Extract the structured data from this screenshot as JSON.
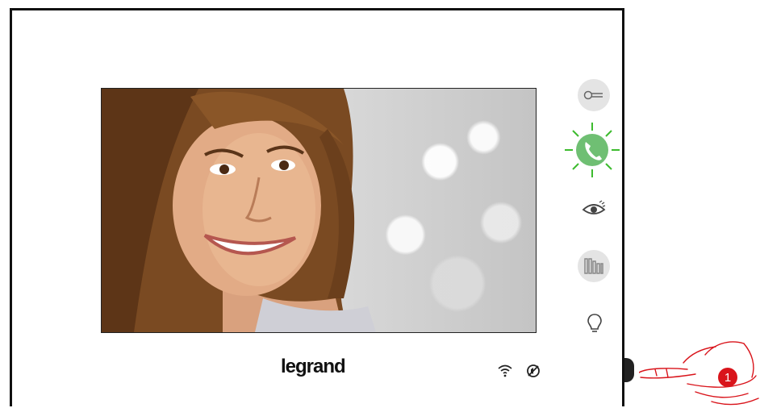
{
  "brand": {
    "logo_text": "legrand"
  },
  "video": {
    "description_icon": "visitor-video-feed"
  },
  "side_buttons": [
    {
      "name": "door-lock-button",
      "icon": "key-icon"
    },
    {
      "name": "answer-call-button",
      "icon": "phone-icon",
      "state": "active-blinking",
      "color": "#6fbf73"
    },
    {
      "name": "camera-view-button",
      "icon": "eye-icon"
    },
    {
      "name": "gate-button",
      "icon": "gate-icon"
    },
    {
      "name": "light-button",
      "icon": "bulb-icon"
    }
  ],
  "status": {
    "wifi": "wifi-icon",
    "mute": "mute-icon"
  },
  "callout": {
    "badge": "1"
  },
  "colors": {
    "accent_green": "#6fbf73",
    "badge_red": "#d9141b",
    "frame": "#111111"
  }
}
